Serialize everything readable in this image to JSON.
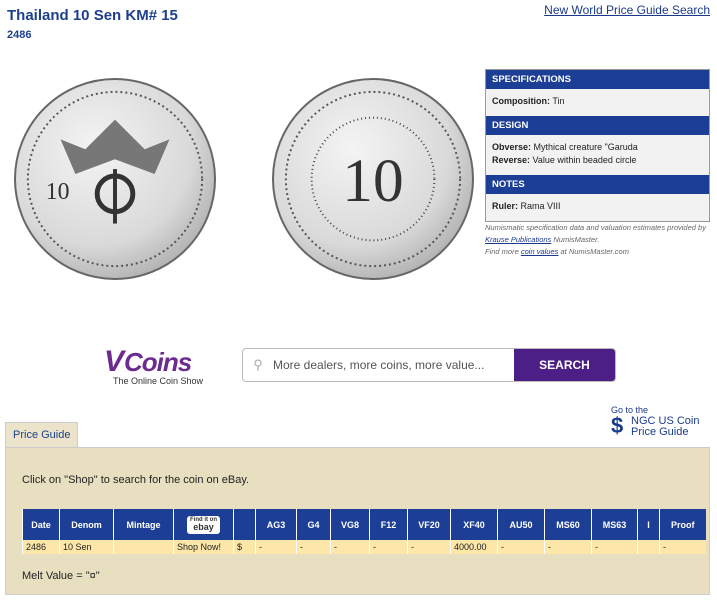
{
  "header": {
    "title": "Thailand 10 Sen KM# 15",
    "subtitle": "2486",
    "search_link": "New World Price Guide Search"
  },
  "specifications": {
    "heading": "SPECIFICATIONS",
    "composition_label": "Composition:",
    "composition_value": "Tin",
    "design_heading": "DESIGN",
    "obverse_label": "Obverse:",
    "obverse_value": "Mythical creature \"Garuda",
    "reverse_label": "Reverse:",
    "reverse_value": "Value within beaded circle",
    "notes_heading": "NOTES",
    "ruler_label": "Ruler:",
    "ruler_value": "Rama VIII"
  },
  "fineprint": {
    "line1": "Numismatic specification data and valuation estimates provided by",
    "krause": "Krause Publications",
    "line1b": "NumisMaster.",
    "line2a": "Find more",
    "coin_values": "coin values",
    "line2b": "at NumisMaster.com"
  },
  "vcoins": {
    "v": "V",
    "word": "Coins",
    "tagline": "The Online Coin Show",
    "placeholder": "More  dealers, more coins, more value...",
    "search_button": "SEARCH"
  },
  "ngc": {
    "goto": "Go to the",
    "symbol": "$",
    "line1": "NGC US Coin",
    "line2": "Price Guide"
  },
  "price_guide": {
    "tab": "Price Guide",
    "instructions": "Click on \"Shop\" to search for the coin on eBay.",
    "ebay_find": "Find it on",
    "ebay_name": "ebay",
    "columns": [
      "Date",
      "Denom",
      "Mintage",
      "",
      "",
      "AG3",
      "G4",
      "VG8",
      "F12",
      "VF20",
      "XF40",
      "AU50",
      "MS60",
      "MS63",
      "I",
      "Proof"
    ],
    "row": [
      "2486",
      "10 Sen",
      "",
      "Shop Now!",
      "$",
      "-",
      "-",
      "-",
      "-",
      "-",
      "4000.00",
      "-",
      "-",
      "-",
      "",
      "-"
    ],
    "melt": "Melt Value = \"¤\""
  },
  "coin_images": {
    "obverse_text": "10",
    "reverse_text": "10"
  }
}
